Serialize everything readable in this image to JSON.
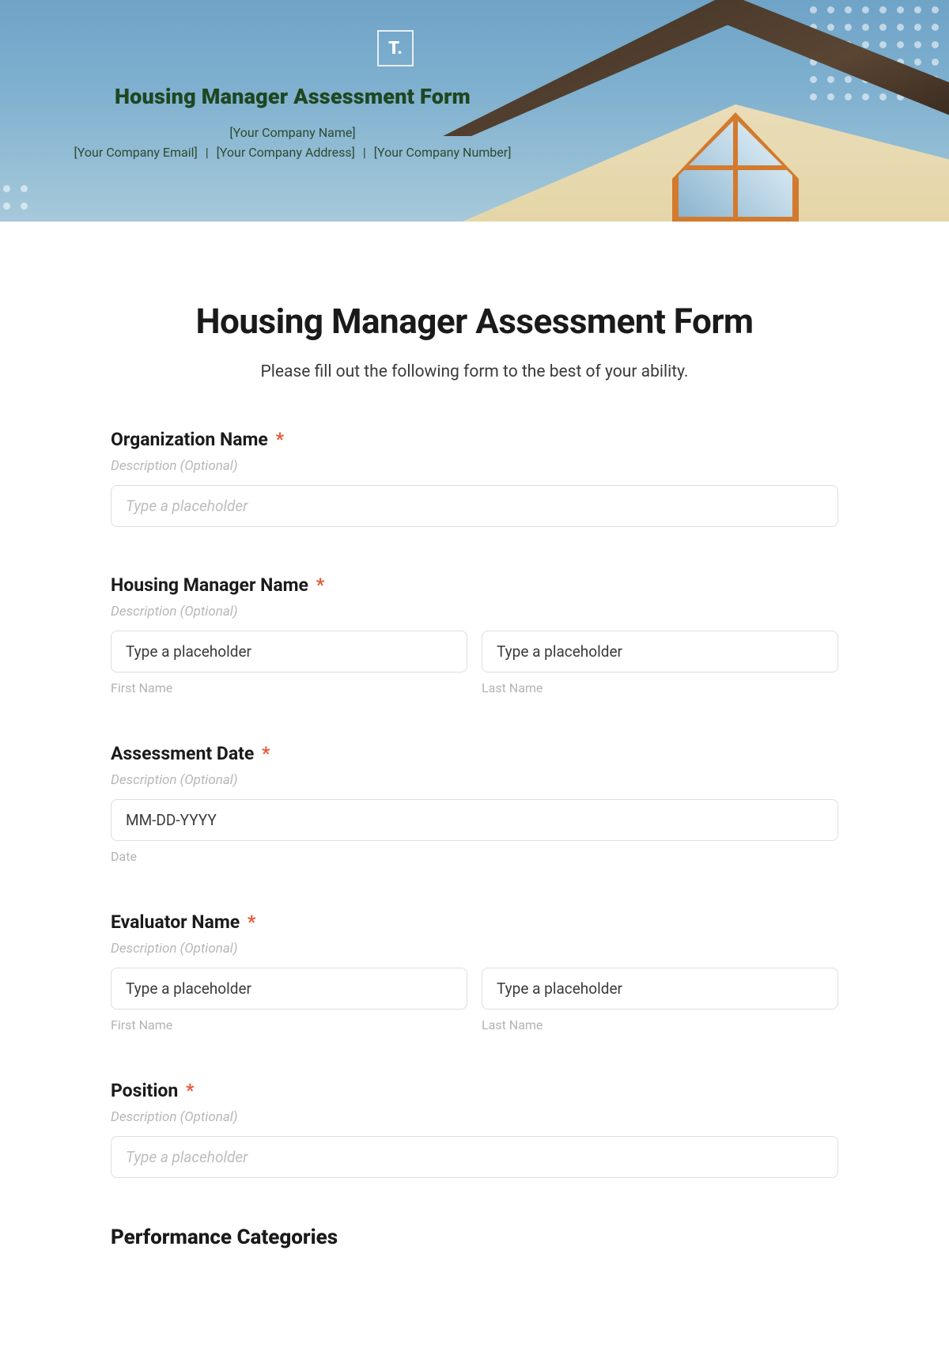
{
  "hero": {
    "logo_text": "T.",
    "title": "Housing Manager Assessment Form",
    "company_name": "[Your Company Name]",
    "company_email": "[Your Company Email]",
    "company_address": "[Your Company Address]",
    "company_number": "[Your Company Number]",
    "separator": "|"
  },
  "form": {
    "title": "Housing Manager Assessment Form",
    "intro": "Please fill out the following form to the best of your ability.",
    "required_mark": "*",
    "desc_placeholder": "Description (Optional)",
    "text_placeholder": "Type a placeholder",
    "first_name_label": "First Name",
    "last_name_label": "Last Name",
    "date_sub": "Date",
    "fields": {
      "org": {
        "label": "Organization Name"
      },
      "manager": {
        "label": "Housing Manager Name"
      },
      "assess_date": {
        "label": "Assessment Date",
        "placeholder": "MM-DD-YYYY"
      },
      "evaluator": {
        "label": "Evaluator Name"
      },
      "position": {
        "label": "Position"
      }
    },
    "section_perf": "Performance Categories"
  }
}
